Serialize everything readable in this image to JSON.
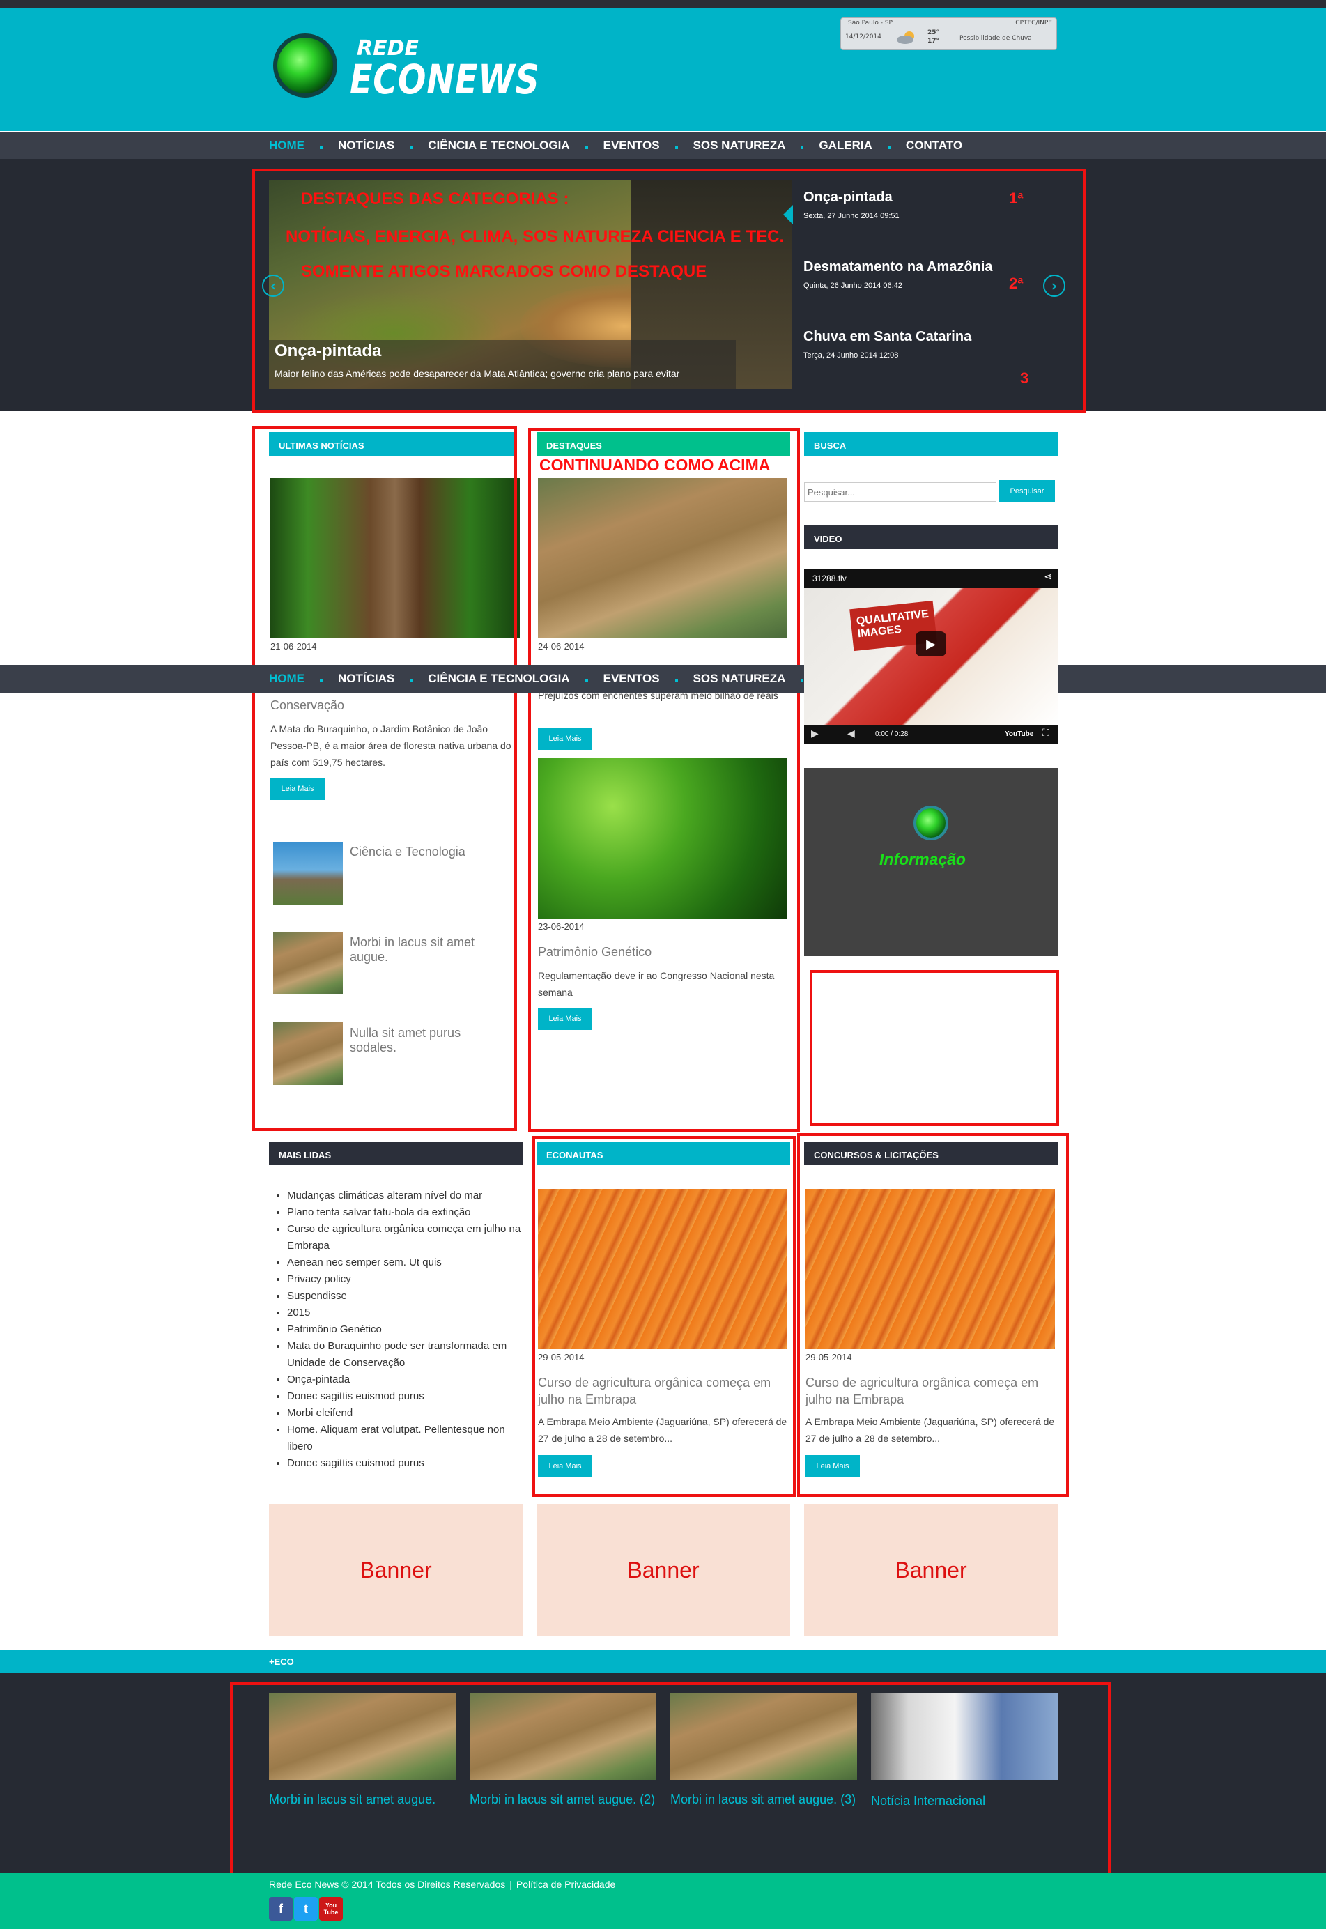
{
  "weather": {
    "city": "São Paulo - SP",
    "source": "CPTEC/INPE",
    "date": "14/12/2014",
    "max": "25°",
    "min": "17°",
    "forecast": "Possibilidade de Chuva"
  },
  "logo": {
    "small": "REDE",
    "big": "ECONEWS"
  },
  "nav": {
    "items": [
      {
        "label": "HOME"
      },
      {
        "label": "NOTÍCIAS"
      },
      {
        "label": "CIÊNCIA E TECNOLOGIA"
      },
      {
        "label": "EVENTOS"
      },
      {
        "label": "SOS NATUREZA"
      },
      {
        "label": "GALERIA"
      },
      {
        "label": "CONTATO"
      }
    ]
  },
  "slider": {
    "annotation": [
      "DESTAQUES DAS CATEGORIAS :",
      "NOTÍCIAS, ENERGIA, CLIMA, SOS NATUREZA CIENCIA E TEC.",
      "SOMENTE ATIGOS MARCADOS COMO DESTAQUE"
    ],
    "caption_title": "Onça-pintada",
    "caption_text": "Maior felino das Américas pode desaparecer da Mata Atlântica; governo cria plano para evitar",
    "list": [
      {
        "title": "Onça-pintada",
        "date": "Sexta, 27 Junho 2014 09:51",
        "mark": "1ª"
      },
      {
        "title": "Desmatamento na Amazônia",
        "date": "Quinta, 26 Junho 2014 06:42",
        "mark": "2ª"
      },
      {
        "title": "Chuva em Santa Catarina",
        "date": "Terça, 24 Junho 2014 12:08",
        "mark": "3"
      }
    ]
  },
  "ultimas": {
    "header": "ULTIMAS NOTÍCIAS",
    "date": "21-06-2014",
    "title": "Conservação",
    "text": "A Mata do Buraquinho, o Jardim Botânico de João Pessoa-PB, é a maior área de floresta nativa urbana do país com 519,75 hectares.",
    "btn": "Leia Mais",
    "small": [
      {
        "title": "Ciência e Tecnologia"
      },
      {
        "title": "Morbi in lacus sit amet augue."
      },
      {
        "title": "Nulla sit amet purus sodales."
      }
    ]
  },
  "destaques": {
    "header": "DESTAQUES",
    "annotation": "CONTINUANDO COMO ACIMA",
    "a1": {
      "date": "24-06-2014",
      "text": "Prejuízos com enchentes superam meio bilhão de reais",
      "btn": "Leia Mais"
    },
    "a2": {
      "date": "23-06-2014",
      "title": "Patrimônio Genético",
      "text": "Regulamentação deve ir ao Congresso Nacional nesta semana",
      "btn": "Leia Mais"
    }
  },
  "busca": {
    "header": "BUSCA",
    "placeholder": "Pesquisar...",
    "btn": "Pesquisar"
  },
  "video": {
    "header": "VIDEO",
    "file": "31288.flv",
    "time": "0:00 / 0:28",
    "overlay": "QUALITATIVE IMAGES",
    "yt": "YouTube"
  },
  "info": {
    "label": "Informação"
  },
  "mais_lidas": {
    "header": "MAIS LIDAS",
    "items": [
      "Mudanças climáticas alteram nível do mar",
      "Plano tenta salvar tatu-bola da extinção",
      "Curso de agricultura orgânica começa em julho na Embrapa",
      "Aenean nec semper sem. Ut quis",
      "Privacy policy",
      "Suspendisse",
      "2015",
      "Patrimônio Genético",
      "Mata do Buraquinho pode ser transformada em Unidade de Conservação",
      "Onça-pintada",
      "Donec sagittis euismod purus",
      "Morbi eleifend",
      "Home. Aliquam erat volutpat. Pellentesque non libero",
      "Donec sagittis euismod purus"
    ]
  },
  "econautas": {
    "header": "ECONAUTAS",
    "date": "29-05-2014",
    "title": "Curso de agricultura orgânica começa em julho na Embrapa",
    "text": "A Embrapa Meio Ambiente (Jaguariúna, SP) oferecerá de 27 de julho a 28 de setembro...",
    "btn": "Leia Mais"
  },
  "concursos": {
    "header": "CONCURSOS & LICITAÇÕES",
    "date": "29-05-2014",
    "title": "Curso de agricultura orgânica começa em julho na Embrapa",
    "text": "A Embrapa Meio Ambiente (Jaguariúna, SP) oferecerá de 27 de julho a 28 de setembro...",
    "btn": "Leia Mais"
  },
  "banners": [
    "Banner",
    "Banner",
    "Banner"
  ],
  "eco": {
    "header": "+ECO",
    "items": [
      "Morbi in lacus sit amet augue.",
      "Morbi in lacus sit amet augue. (2)",
      "Morbi in lacus sit amet augue. (3)",
      "Notícia Internacional"
    ]
  },
  "footer": {
    "copyright": "Rede Eco News © 2014 Todos os Direitos Reservados",
    "sep": "|",
    "privacy": "Política de Privacidade",
    "social": [
      "f",
      "t",
      "You Tube"
    ]
  },
  "colors": {
    "teal": "#00b4c8",
    "green": "#00c08c",
    "dark": "#262a33",
    "annotation_red": "#ee1111"
  }
}
